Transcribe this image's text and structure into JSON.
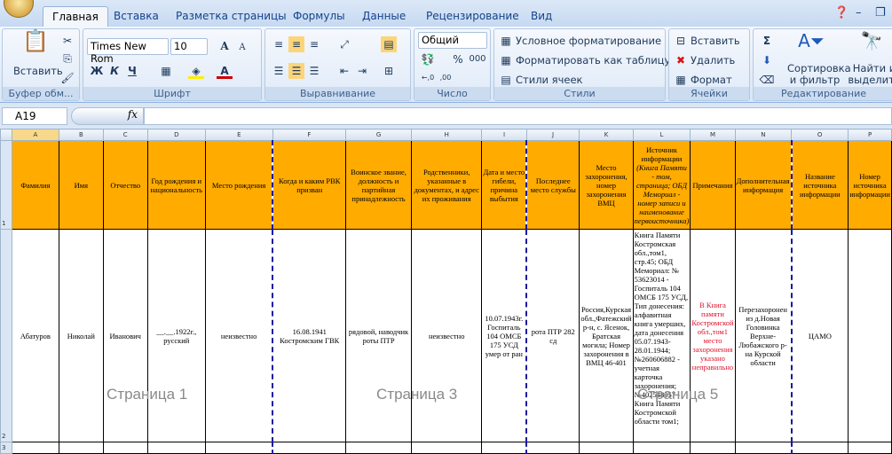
{
  "tabs": [
    "Главная",
    "Вставка",
    "Разметка страницы",
    "Формулы",
    "Данные",
    "Рецензирование",
    "Вид"
  ],
  "active_tab": "Главная",
  "ribbon": {
    "clipboard": {
      "label": "Буфер обм...",
      "paste": "Вставить"
    },
    "font": {
      "label": "Шрифт",
      "name": "Times New Rom",
      "size": "10",
      "bold": "Ж",
      "italic": "К",
      "underline": "Ч"
    },
    "alignment": {
      "label": "Выравнивание"
    },
    "number": {
      "label": "Число",
      "format": "Общий",
      "percent": "%",
      "thousands": "000"
    },
    "styles": {
      "label": "Стили",
      "conditional": "Условное форматирование",
      "format_table": "Форматировать как таблицу",
      "cell_styles": "Стили ячеек"
    },
    "cells": {
      "label": "Ячейки",
      "insert": "Вставить",
      "delete": "Удалить",
      "format": "Формат"
    },
    "editing": {
      "label": "Редактирование",
      "sort": "Сортировка и фильтр",
      "find": "Найти и выделить"
    }
  },
  "formula_bar": {
    "name_box": "A19",
    "fx": "fx",
    "value": ""
  },
  "accent": "#ffab00",
  "columns": [
    "A",
    "B",
    "C",
    "D",
    "E",
    "F",
    "G",
    "H",
    "I",
    "J",
    "K",
    "L",
    "M",
    "N",
    "O",
    "P"
  ],
  "rows": [
    "1",
    "2",
    "3"
  ],
  "headers": [
    "Фамилия",
    "Имя",
    "Отчество",
    "Год рождения и национальность",
    "Место рождения",
    "Когда и каким РВК призван",
    "Воинское звание, должность и партийная принадлежность",
    "Родственники, указанные в документах, и адрес их проживания",
    "Дата и место гибели, причина выбытия",
    "Последнее место службы",
    "Место захоронения, номер захоронения ВМЦ",
    "Источник информации",
    "Примечания",
    "Дополнительная информация",
    "Название источника информации",
    "Номер источника информации"
  ],
  "header_L_note": "(Книга Памяти - том, страница; ОБД Мемориал - номер записи и наименование первоисточника)",
  "record": [
    "Абатуров",
    "Николай",
    "Иванович",
    "__.__.1922г., русский",
    "неизвестно",
    "16.08.1941 Костромским ГВК",
    "рядовой, наводчик роты ПТР",
    "неизвестно",
    "10.07.1943г. Госпиталь 104 ОМСБ 175 УСД умер от ран",
    "рота ПТР 282 сд",
    "Россия,Курская обл.,Фатежский р-н, с. Ясенок, Братская могила; Номер захоронения в ВМЦ 46-401",
    "Книга Памяти Костромская обл.,том1, стр.45; ОБД Мемориал: № 53623014 - Госпиталь 104 ОМСБ 175 УСД, Тип донесения: алфавитная книга умерших, дата донесения 05.07.1943-28.01.1944; №260606882 - учетная карточка захоронения; №402548057 - Книга Памяти Костромской области том1;",
    "В Книга памяти Костромской обл.,том1 место захоронения указано неправильно",
    "Перезахоронен из д.Новая Головинка Верхне-Любажского р-на Курской области",
    "ЦАМО",
    ""
  ],
  "page_labels": [
    "Страница 1",
    "Страница 3",
    "Страница 5"
  ]
}
